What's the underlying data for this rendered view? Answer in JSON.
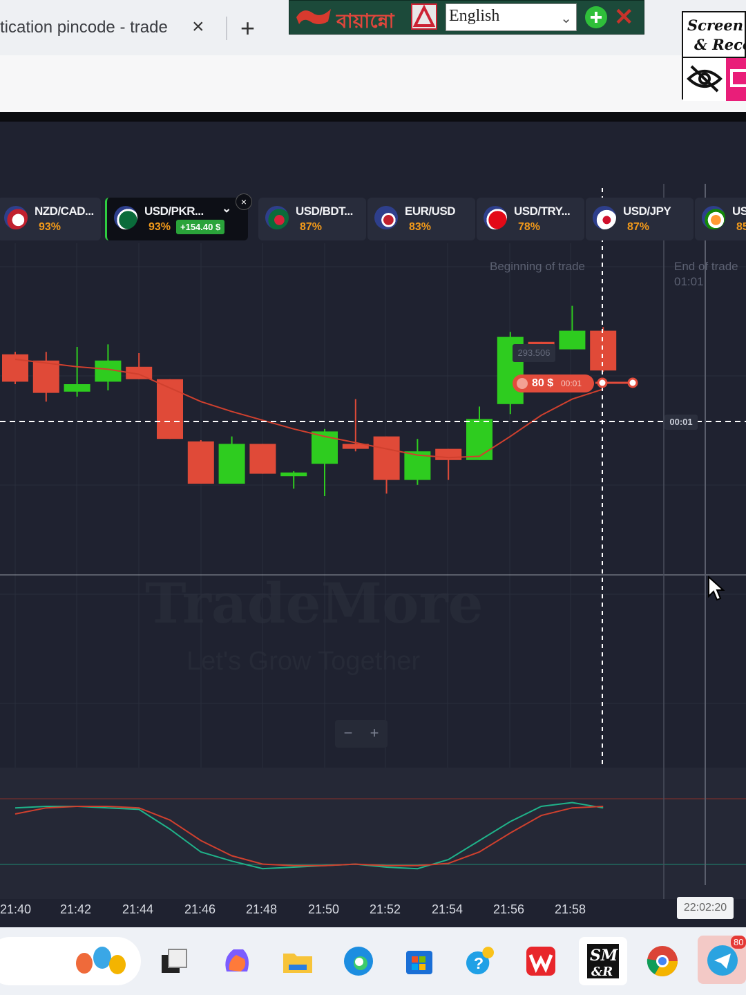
{
  "browser": {
    "tab_title": "tication pincode - trade",
    "tab_close": "×",
    "new_tab": "+"
  },
  "lang_toolbar": {
    "brand": "বায়ান্নো",
    "language": "English",
    "chevron": "⌄",
    "close": "✕"
  },
  "screen_recorder": {
    "label_line1": "Screen Ma",
    "label_line2": "& Recor"
  },
  "assets": [
    {
      "name": "NZD/CAD...",
      "pct": "93%"
    },
    {
      "name": "USD/PKR...",
      "pct": "93%",
      "pl": "+154.40 $",
      "active": true
    },
    {
      "name": "USD/BDT...",
      "pct": "87%"
    },
    {
      "name": "EUR/USD",
      "pct": "83%"
    },
    {
      "name": "USD/TRY...",
      "pct": "78%"
    },
    {
      "name": "USD/JPY",
      "pct": "87%"
    },
    {
      "name": "US",
      "pct": "85"
    }
  ],
  "active_close": "×",
  "chart": {
    "beginning_label": "Beginning of trade",
    "end_label": "End of trade",
    "end_time": "01:01",
    "price_tag": "293.506",
    "trade_amount": "80 $",
    "trade_time": "00:01",
    "timer": "00:01",
    "watermark": "TradeMore",
    "watermark_sub": "Let's Grow Together",
    "zoom_minus": "−",
    "zoom_plus": "+",
    "clock": "22:02:20",
    "colors": {
      "up": "#2ecc1f",
      "down": "#e04a38",
      "ma": "#d0402e",
      "osc_green": "#1fb38a",
      "osc_red": "#d0402e"
    }
  },
  "chart_data": {
    "type": "candlestick",
    "x_ticks": [
      "21:40",
      "21:42",
      "21:44",
      "21:46",
      "21:48",
      "21:50",
      "21:52",
      "21:54",
      "21:56",
      "21:58"
    ],
    "candles": [
      {
        "o": 3.2,
        "c": 5.4,
        "h": 5.6,
        "l": 3.0,
        "dir": "down"
      },
      {
        "o": 4.9,
        "c": 2.3,
        "h": 5.6,
        "l": 1.6,
        "dir": "down"
      },
      {
        "o": 2.4,
        "c": 3.0,
        "h": 6.0,
        "l": 2.0,
        "dir": "up"
      },
      {
        "o": 3.2,
        "c": 4.9,
        "h": 6.2,
        "l": 2.5,
        "dir": "up"
      },
      {
        "o": 4.4,
        "c": 3.4,
        "h": 5.5,
        "l": 3.4,
        "dir": "down"
      },
      {
        "o": 3.4,
        "c": -1.4,
        "h": 3.4,
        "l": -1.4,
        "dir": "down"
      },
      {
        "o": -1.6,
        "c": -5.0,
        "h": -1.5,
        "l": -5.0,
        "dir": "down"
      },
      {
        "o": -5.0,
        "c": -1.8,
        "h": -1.2,
        "l": -5.0,
        "dir": "up"
      },
      {
        "o": -1.8,
        "c": -4.2,
        "h": -1.8,
        "l": -4.2,
        "dir": "down"
      },
      {
        "o": -4.1,
        "c": -4.4,
        "h": -4.0,
        "l": -5.4,
        "dir": "up"
      },
      {
        "o": -3.4,
        "c": -0.8,
        "h": -0.6,
        "l": -6.0,
        "dir": "up"
      },
      {
        "o": -2.2,
        "c": -1.8,
        "h": 1.8,
        "l": -2.4,
        "dir": "down"
      },
      {
        "o": -1.2,
        "c": -4.7,
        "h": -1.2,
        "l": -5.8,
        "dir": "down"
      },
      {
        "o": -4.7,
        "c": -2.4,
        "h": -1.4,
        "l": -5.1,
        "dir": "up"
      },
      {
        "o": -2.2,
        "c": -3.1,
        "h": -2.2,
        "l": -4.7,
        "dir": "down"
      },
      {
        "o": -3.1,
        "c": 0.2,
        "h": 1.2,
        "l": -3.1,
        "dir": "up"
      },
      {
        "o": 1.4,
        "c": 6.8,
        "h": 7.2,
        "l": 0.6,
        "dir": "up"
      },
      {
        "o": 6.4,
        "c": 5.6,
        "h": 6.4,
        "l": 4.9,
        "dir": "down"
      },
      {
        "o": 5.8,
        "c": 7.3,
        "h": 9.3,
        "l": 5.8,
        "dir": "up"
      },
      {
        "o": 7.3,
        "c": 4.1,
        "h": 7.6,
        "l": 4.0,
        "dir": "down"
      }
    ],
    "ma": [
      5.0,
      4.7,
      4.4,
      4.2,
      3.8,
      2.7,
      1.6,
      0.8,
      0.1,
      -0.6,
      -1.2,
      -1.7,
      -2.2,
      -2.7,
      -2.9,
      -2.8,
      -1.2,
      0.5,
      1.8,
      2.6
    ],
    "oscillator_green": [
      88,
      90,
      90,
      88,
      86,
      60,
      30,
      18,
      8,
      10,
      12,
      14,
      10,
      8,
      20,
      45,
      70,
      90,
      95,
      88
    ],
    "oscillator_red": [
      80,
      88,
      90,
      90,
      88,
      72,
      45,
      25,
      14,
      12,
      12,
      14,
      12,
      12,
      15,
      30,
      55,
      78,
      88,
      90
    ],
    "ylim": [
      -10,
      14
    ]
  },
  "taskbar": {
    "badge": "80"
  }
}
